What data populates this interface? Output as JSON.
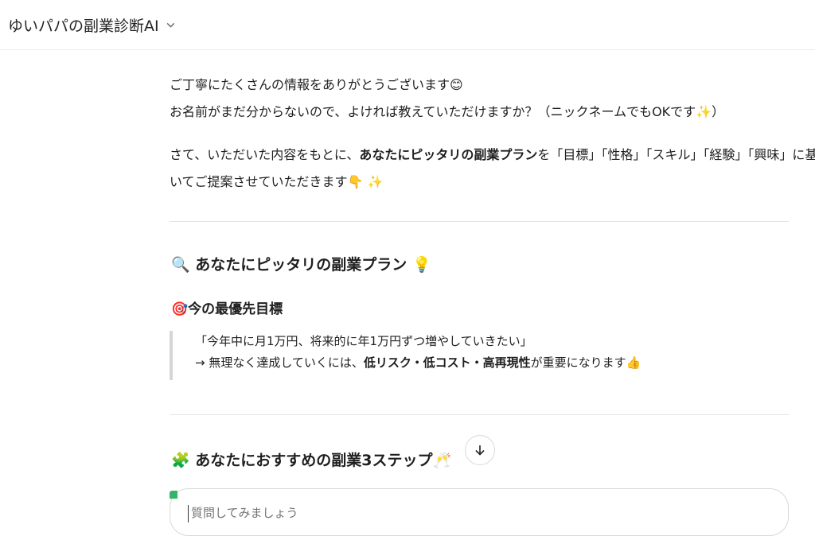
{
  "header": {
    "model_name": "ゆいパパの副業診断AI"
  },
  "intro": {
    "line1": "ご丁寧にたくさんの情報をありがとうございます",
    "line1_emoji": "😊",
    "line2": "お名前がまだ分からないので、よければ教えていただけますか？（ニックネームでもOKです",
    "line2_emoji": "✨",
    "line2_end": "）",
    "line3_a": "さて、いただいた内容をもとに、",
    "line3_b": "あなたにピッタリの副業プラン",
    "line3_c": "を「目標」「性格」「スキル」「経験」「興味」に基づ",
    "line4": "いてご提案させていただきます",
    "line4_emoji": "👇 ✨"
  },
  "plan": {
    "heading_icon": "🔍",
    "heading": "あなたにピッタリの副業プラン",
    "heading_icon2": "💡",
    "goal_icon": "🎯",
    "goal_heading": "今の最優先目標",
    "quote_line1": "「今年中に月1万円、将来的に年1万円ずつ増やしていきたい」",
    "quote_line2_a": "→ 無理なく達成していくには、",
    "quote_line2_b": "低リスク・低コスト・高再現性",
    "quote_line2_c": "が重要になります",
    "quote_line2_emoji": "👍"
  },
  "steps": {
    "heading_icon": "🧩",
    "heading": "あなたにおすすめの副業3ステップ",
    "heading_icon2": "🥂"
  },
  "composer": {
    "placeholder": "質問してみましょう"
  },
  "icons": {
    "chevron": "chevron-down-icon",
    "scroll": "arrow-down-icon"
  }
}
